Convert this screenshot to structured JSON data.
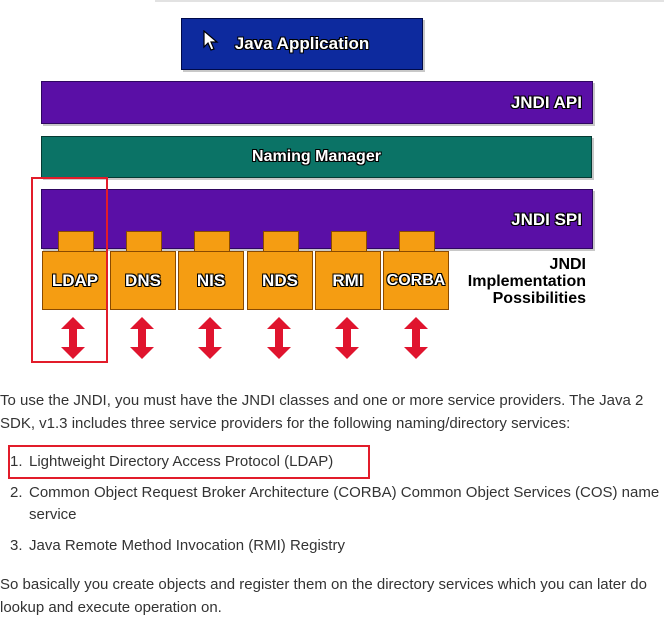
{
  "diagram": {
    "java_app_label": "Java Application",
    "jndi_api_label": "JNDI API",
    "naming_manager_label": "Naming Manager",
    "jndi_spi_label": "JNDI SPI",
    "providers": [
      "LDAP",
      "DNS",
      "NIS",
      "NDS",
      "RMI",
      "CORBA"
    ],
    "impl_lines": [
      "JNDI",
      "Implementation",
      "Possibilities"
    ],
    "colors": {
      "java_app": "#0d2a9e",
      "api_spi": "#5a0fa6",
      "naming_manager": "#0b7366",
      "provider": "#f59d12",
      "arrow": "#e0142e",
      "highlight": "#e21c2a"
    }
  },
  "article": {
    "intro": "To use the JNDI, you must have the JNDI classes and one or more service providers. The Java 2 SDK, v1.3 includes three service providers for the following naming/directory services:",
    "list": [
      {
        "num": "1.",
        "text": "Lightweight Directory Access Protocol (LDAP)"
      },
      {
        "num": "2.",
        "text": "Common Object Request Broker Architecture (CORBA) Common Object Services (COS) name service"
      },
      {
        "num": "3.",
        "text": "Java Remote Method Invocation (RMI) Registry"
      }
    ],
    "outro": "So basically you create objects and register them on the directory services which you can later do lookup and execute operation on."
  }
}
